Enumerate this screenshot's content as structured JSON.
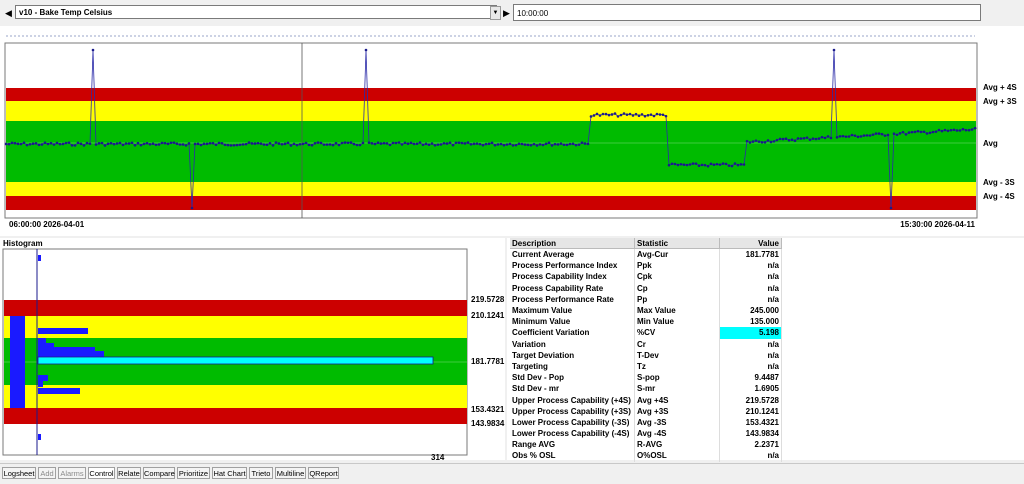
{
  "toolbar": {
    "variable_label": "v10 - Bake Temp Celsius",
    "time_value": "10:00:00"
  },
  "control_chart": {
    "start_time": "06:00:00 2026-04-01",
    "end_time": "15:30:00 2026-04-11",
    "band_labels": [
      "Avg + 4S",
      "Avg + 3S",
      "Avg",
      "Avg - 3S",
      "Avg - 4S"
    ],
    "colors": {
      "red": "#cc0000",
      "yellow": "#ffff00",
      "green": "#00bb00",
      "series": "#1a1a8c"
    }
  },
  "histogram": {
    "title": "Histogram",
    "limit_labels": [
      "219.5728",
      "210.1241",
      "181.7781",
      "153.4321",
      "143.9834"
    ],
    "max_count_label": "314"
  },
  "stats_table": {
    "headers": [
      "Description",
      "Statistic",
      "Value"
    ],
    "rows": [
      [
        "Current Average",
        "Avg-Cur",
        "181.7781"
      ],
      [
        "Process Performance Index",
        "Ppk",
        "n/a"
      ],
      [
        "Process Capability Index",
        "Cpk",
        "n/a"
      ],
      [
        "Process Capability Rate",
        "Cp",
        "n/a"
      ],
      [
        "Process Performance Rate",
        "Pp",
        "n/a"
      ],
      [
        "Maximum Value",
        "Max Value",
        "245.000"
      ],
      [
        "Minimum Value",
        "Min Value",
        "135.000"
      ],
      [
        "Coefficient Variation",
        "%CV",
        "5.198"
      ],
      [
        "Variation",
        "Cr",
        "n/a"
      ],
      [
        "Target Deviation",
        "T-Dev",
        "n/a"
      ],
      [
        "Targeting",
        "Tz",
        "n/a"
      ],
      [
        "Std Dev - Pop",
        "S-pop",
        "9.4487"
      ],
      [
        "Std Dev - mr",
        "S-mr",
        "1.6905"
      ],
      [
        "Upper Process Capability (+4S)",
        "Avg +4S",
        "219.5728"
      ],
      [
        "Upper Process Capability (+3S)",
        "Avg +3S",
        "210.1241"
      ],
      [
        "Lower Process Capability (-3S)",
        "Avg -3S",
        "153.4321"
      ],
      [
        "Lower Process Capability (-4S)",
        "Avg -4S",
        "143.9834"
      ],
      [
        "Range AVG",
        "R-AVG",
        "2.2371"
      ],
      [
        "Obs % OSL",
        "O%OSL",
        "n/a"
      ]
    ],
    "highlight_color": "#00ffff"
  },
  "tabs": [
    {
      "label": "Logsheet",
      "enabled": true
    },
    {
      "label": "Add",
      "enabled": false
    },
    {
      "label": "Alarms",
      "enabled": false
    },
    {
      "label": "Control",
      "enabled": true,
      "active": true
    },
    {
      "label": "Relate",
      "enabled": true
    },
    {
      "label": "Compare",
      "enabled": true
    },
    {
      "label": "Prioritize",
      "enabled": true
    },
    {
      "label": "Hat Chart",
      "enabled": true
    },
    {
      "label": "Trieto",
      "enabled": true
    },
    {
      "label": "Multiline",
      "enabled": true
    },
    {
      "label": "QReport",
      "enabled": true
    }
  ]
}
